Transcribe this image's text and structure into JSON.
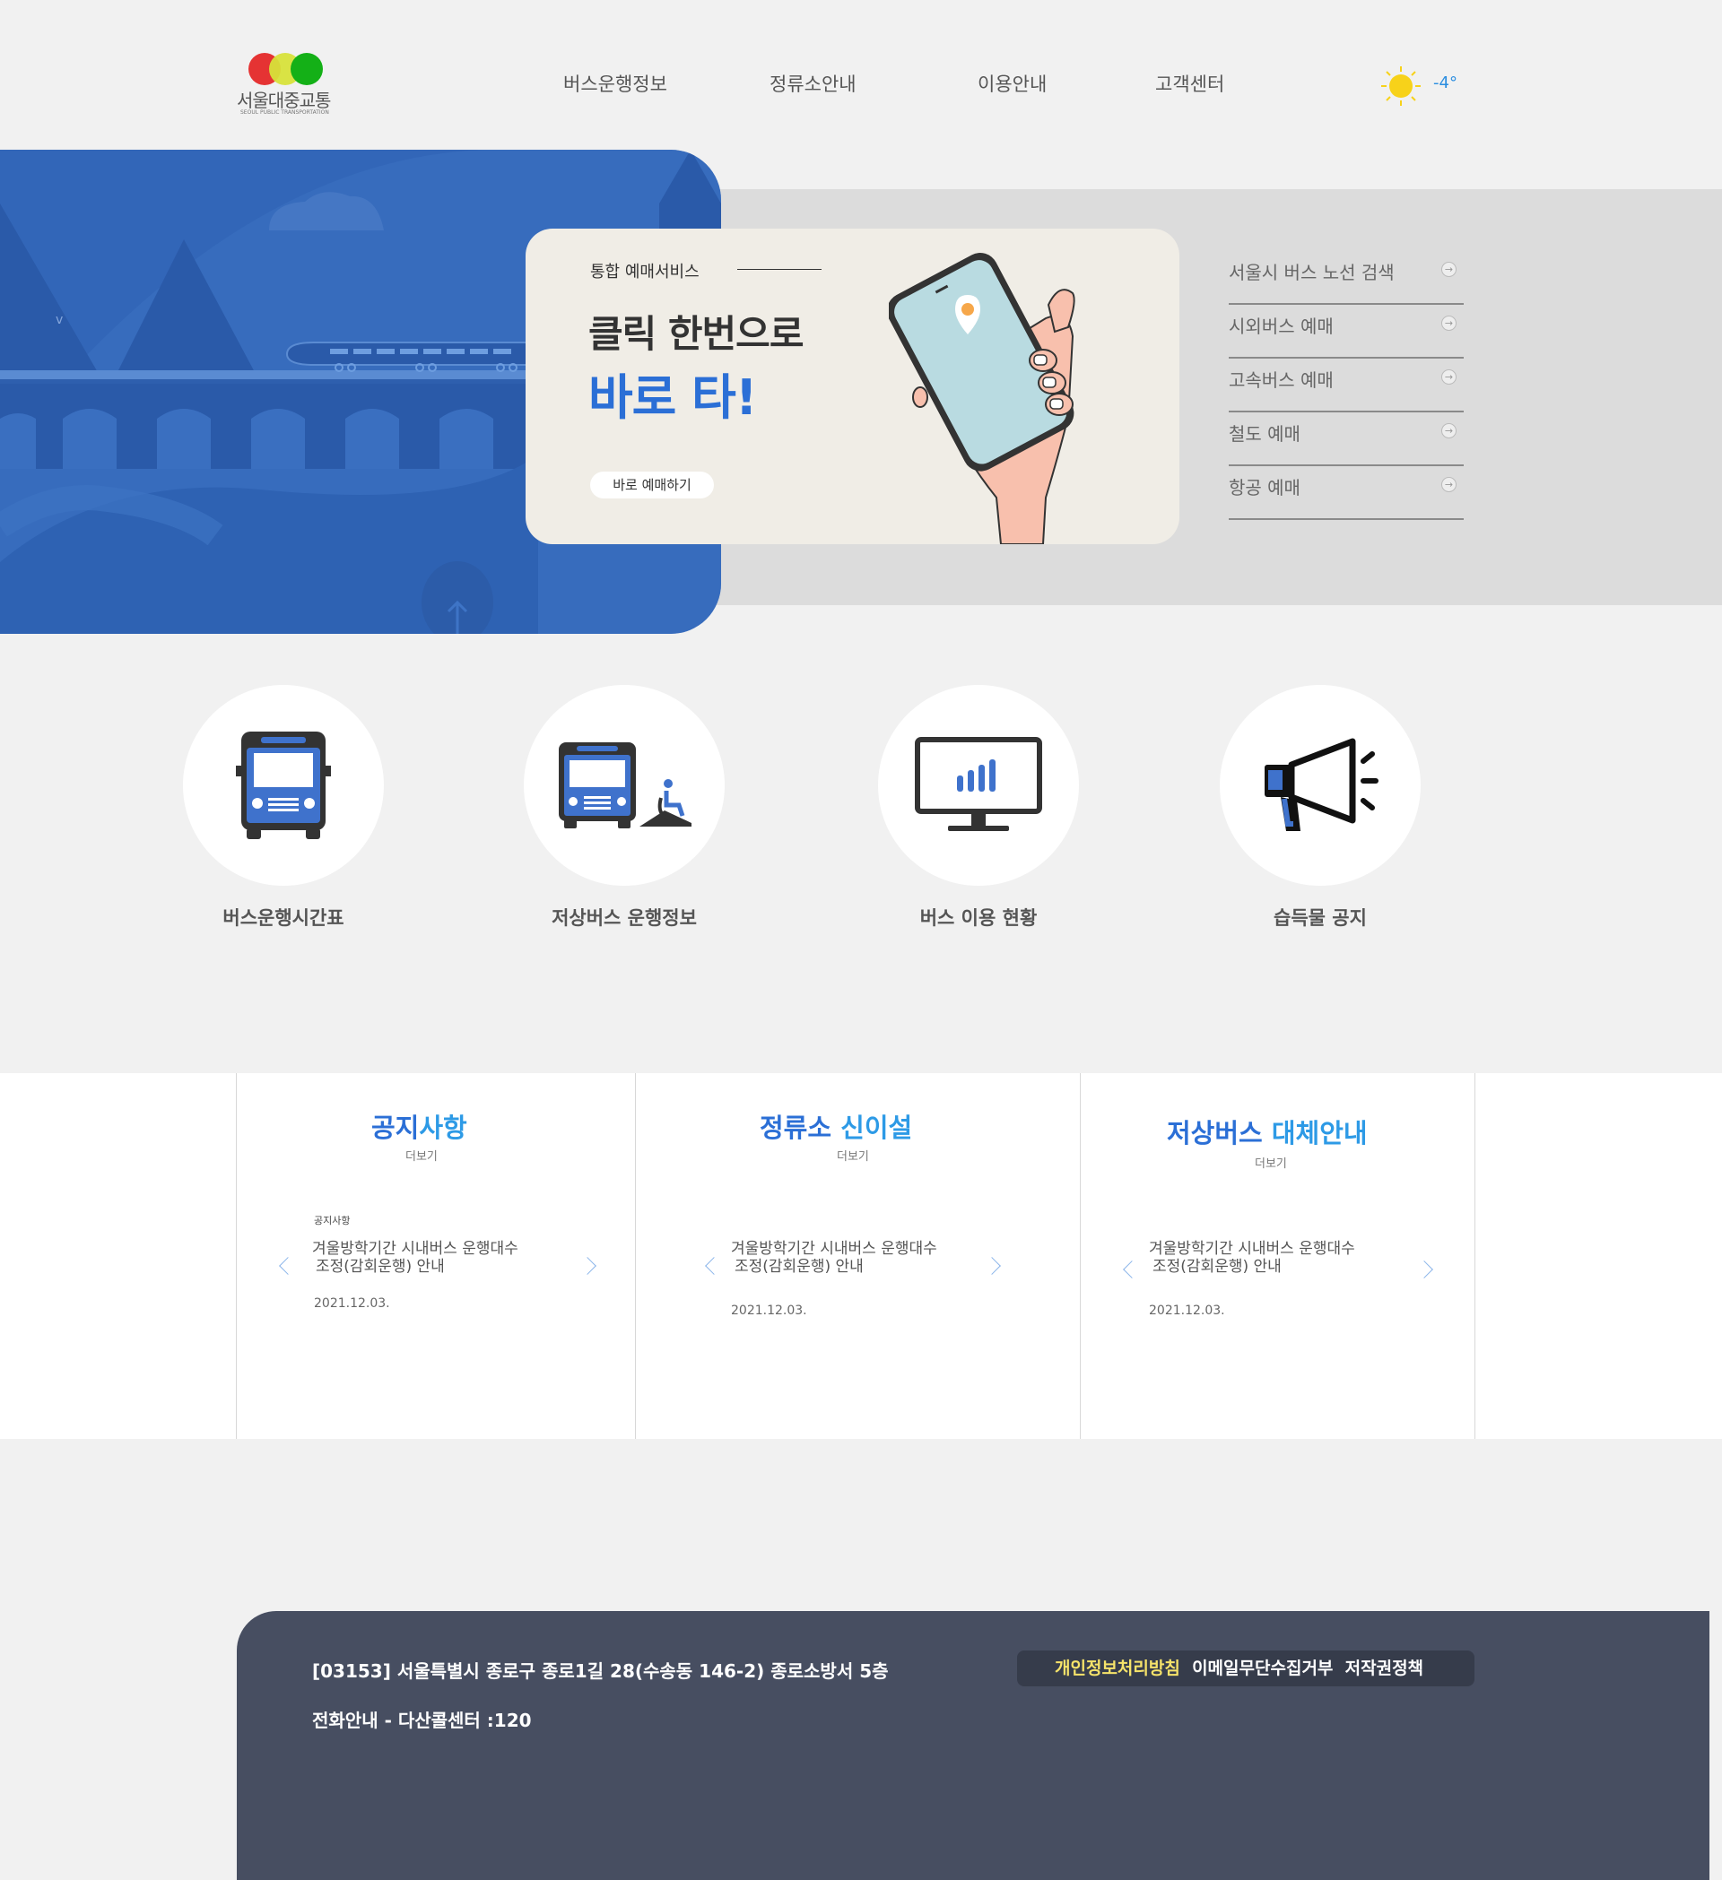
{
  "header": {
    "logo": {
      "name": "서울대중교통",
      "sub": "SEOUL PUBLIC TRANSPORTATION",
      "dots": [
        "#e53333",
        "#d7e23a",
        "#14b017"
      ]
    },
    "nav": [
      "버스운행정보",
      "정류소안내",
      "이용안내",
      "고객센터"
    ],
    "weather": {
      "icon": "sun-icon",
      "temp": "-4°"
    }
  },
  "hero": {
    "panel_mark": "v",
    "card": {
      "eyebrow": "통합 예매서비스",
      "headline1": "클릭 한번으로",
      "headline2": "바로 타!",
      "button": "바로 예매하기"
    },
    "quick_links": [
      "서울시 버스 노선 검색",
      "시외버스 예매",
      "고속버스 예매",
      "철도 예매",
      "항공 예매"
    ],
    "arrow": "→"
  },
  "services": [
    {
      "label": "버스운행시간표",
      "icon": "bus-icon"
    },
    {
      "label": "저상버스 운행정보",
      "icon": "low-floor-bus-icon"
    },
    {
      "label": "버스 이용 현황",
      "icon": "monitor-chart-icon"
    },
    {
      "label": "습득물 공지",
      "icon": "megaphone-icon"
    }
  ],
  "notices": [
    {
      "title_a": "공지",
      "title_b": "사항",
      "more": "더보기",
      "tag": "공지사항",
      "line1": "겨울방학기간 시내버스 운행대수",
      "line2": "조정(감회운행) 안내",
      "date": "2021.12.03."
    },
    {
      "title_a": "정류소",
      "title_b": "신이설",
      "more": "더보기",
      "tag": "",
      "line1": "겨울방학기간 시내버스 운행대수",
      "line2": "조정(감회운행) 안내",
      "date": "2021.12.03."
    },
    {
      "title_a": "저상버스",
      "title_b": "대체안내",
      "more": "더보기",
      "tag": "",
      "line1": "겨울방학기간 시내버스 운행대수",
      "line2": "조정(감회운행) 안내",
      "date": "2021.12.03."
    }
  ],
  "footer": {
    "address": "[03153] 서울특별시 종로구 종로1길 28(수송동 146-2) 종로소방서 5층",
    "phone": "전화안내 - 다산콜센터 :120",
    "links": [
      "개인정보처리방침",
      "이메일무단수집거부",
      "저작권정책"
    ]
  },
  "colors": {
    "accent_blue": "#2b6fd6",
    "bg": "#f1f1f1",
    "footer": "#474e61",
    "highlight": "#f6e36a"
  }
}
